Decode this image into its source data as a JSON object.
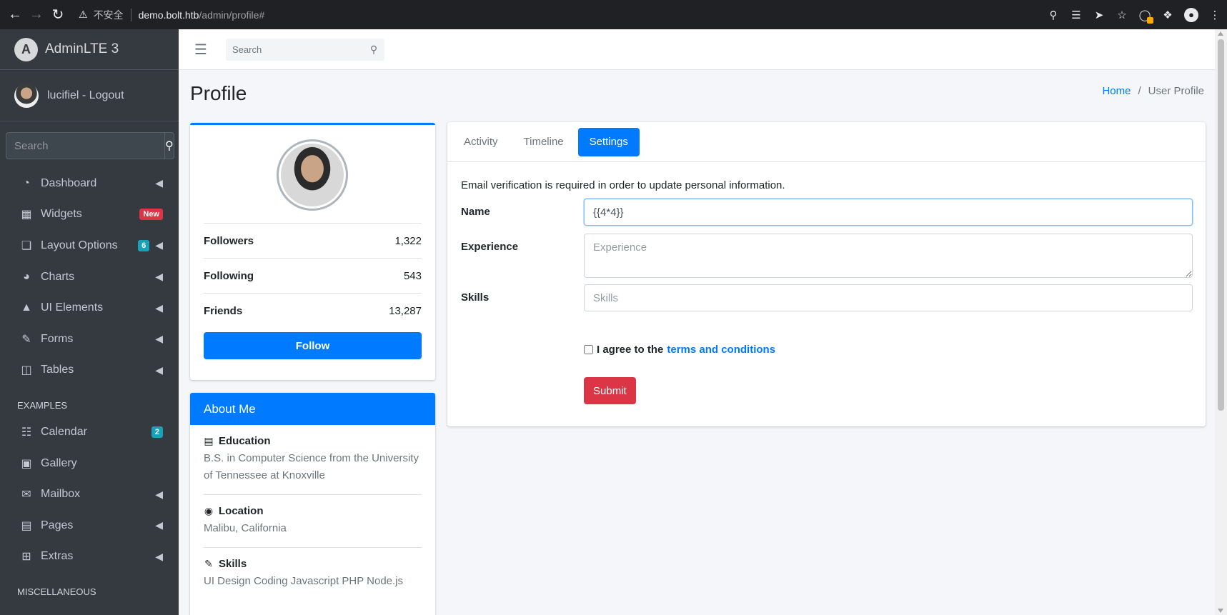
{
  "browser": {
    "insecure_label": "不安全",
    "url_host": "demo.bolt.htb",
    "url_path": "/admin/profile#"
  },
  "brand": {
    "name": "AdminLTE 3",
    "logo_letter": "A"
  },
  "user": {
    "name": "lucifiel - Logout"
  },
  "sidebar_search": {
    "placeholder": "Search"
  },
  "nav": {
    "dashboard": "Dashboard",
    "widgets": "Widgets",
    "widgets_badge": "New",
    "layout": "Layout Options",
    "layout_badge": "6",
    "charts": "Charts",
    "ui": "UI Elements",
    "forms": "Forms",
    "tables": "Tables",
    "header_examples": "EXAMPLES",
    "calendar": "Calendar",
    "calendar_badge": "2",
    "gallery": "Gallery",
    "mailbox": "Mailbox",
    "pages": "Pages",
    "extras": "Extras",
    "header_misc": "MISCELLANEOUS"
  },
  "topbar": {
    "search_placeholder": "Search"
  },
  "page": {
    "title": "Profile",
    "breadcrumb_home": "Home",
    "breadcrumb_sep": "/",
    "breadcrumb_current": "User Profile"
  },
  "profile": {
    "stats": [
      {
        "label": "Followers",
        "value": "1,322"
      },
      {
        "label": "Following",
        "value": "543"
      },
      {
        "label": "Friends",
        "value": "13,287"
      }
    ],
    "follow_label": "Follow"
  },
  "about": {
    "header": "About Me",
    "education_title": "Education",
    "education_text": "B.S. in Computer Science from the University of Tennessee at Knoxville",
    "location_title": "Location",
    "location_text": "Malibu, California",
    "skills_title": "Skills",
    "skills_text": "UI Design Coding Javascript PHP Node.js"
  },
  "settings": {
    "tabs": [
      "Activity",
      "Timeline",
      "Settings"
    ],
    "notice": "Email verification is required in order to update personal information.",
    "name_label": "Name",
    "name_value": "{{4*4}}",
    "experience_label": "Experience",
    "experience_placeholder": "Experience",
    "skills_label": "Skills",
    "skills_placeholder": "Skills",
    "agree_prefix": "I agree to the",
    "agree_link": "terms and conditions",
    "submit_label": "Submit"
  },
  "colors": {
    "primary": "#007bff",
    "danger": "#dc3545",
    "info": "#17a2b8",
    "sidebar_bg": "#343a40"
  }
}
